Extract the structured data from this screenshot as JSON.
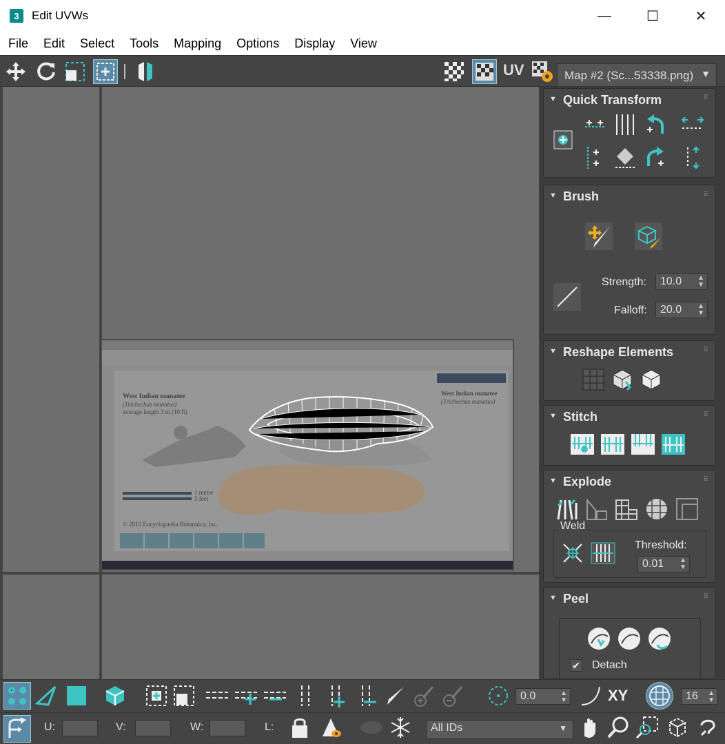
{
  "window": {
    "title": "Edit UVWs",
    "app_icon": "3",
    "minimize": "—",
    "maximize": "☐",
    "close": "✕"
  },
  "menu": [
    "File",
    "Edit",
    "Select",
    "Tools",
    "Mapping",
    "Options",
    "Display",
    "View"
  ],
  "toolbar": {
    "uv_label": "UV",
    "map_dropdown": "Map #2 (Sc...53338.png)"
  },
  "texture_text": {
    "title": "West Indian manatee",
    "latin": "(Trichechus manatus)",
    "length": "average length 3 m (10 ft)",
    "scale1": "1 metre",
    "scale2": "3 feet",
    "side_title": "West Indian manatee",
    "side_latin": "(Trichechus manatus)",
    "copyright": "© 2010 Encyclopædia Britannica, Inc."
  },
  "panels": {
    "quick_transform": "Quick Transform",
    "brush": "Brush",
    "strength_label": "Strength:",
    "strength_value": "10.0",
    "falloff_label": "Falloff:",
    "falloff_value": "20.0",
    "reshape": "Reshape Elements",
    "stitch": "Stitch",
    "explode": "Explode",
    "weld": "Weld",
    "threshold_label": "Threshold:",
    "threshold_value": "0.01",
    "peel": "Peel",
    "detach": "Detach"
  },
  "bottom": {
    "rotate_value": "0.0",
    "xy_label": "XY",
    "grid_value": "16",
    "u_label": "U:",
    "v_label": "V:",
    "w_label": "W:",
    "l_label": "L:",
    "ids_dropdown": "All IDs"
  },
  "colors": {
    "accent": "#3fc4c4",
    "panel": "#474747",
    "viewport": "#6e6e6e"
  }
}
